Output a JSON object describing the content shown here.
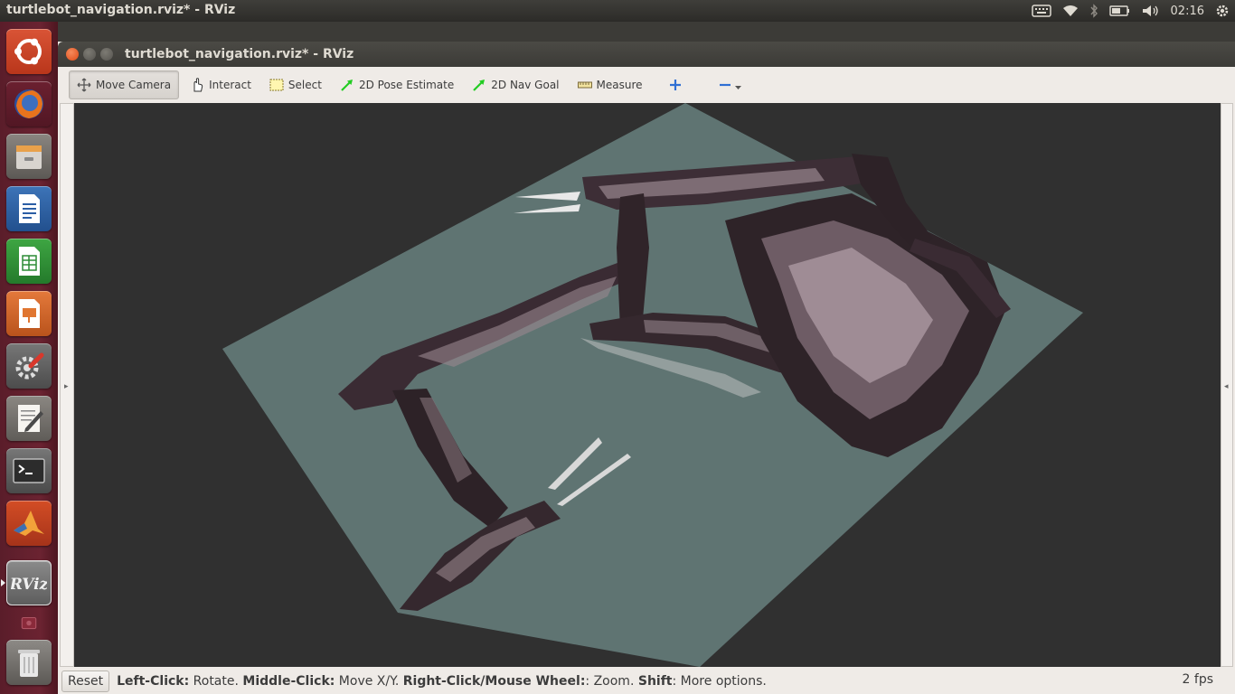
{
  "top_panel": {
    "title": "turtlebot_navigation.rviz* - RViz",
    "clock": "02:16",
    "tray_icons": [
      "keyboard-icon",
      "wifi-icon",
      "bluetooth-icon",
      "battery-icon",
      "volume-icon",
      "gear-icon"
    ]
  },
  "launcher": {
    "items": [
      {
        "name": "ubuntu-dash-icon"
      },
      {
        "name": "firefox-icon"
      },
      {
        "name": "files-icon"
      },
      {
        "name": "libreoffice-writer-icon"
      },
      {
        "name": "libreoffice-calc-icon"
      },
      {
        "name": "libreoffice-impress-icon"
      },
      {
        "name": "system-settings-icon"
      },
      {
        "name": "text-editor-icon"
      },
      {
        "name": "terminal-icon"
      },
      {
        "name": "matlab-icon"
      },
      {
        "name": "rviz-icon",
        "label": "RViz"
      },
      {
        "name": "workspace-icon"
      },
      {
        "name": "trash-icon"
      }
    ]
  },
  "window": {
    "title": "turtlebot_navigation.rviz* - RViz"
  },
  "toolbar": {
    "move_camera": "Move Camera",
    "interact": "Interact",
    "select": "Select",
    "pose_estimate": "2D Pose Estimate",
    "nav_goal": "2D Nav Goal",
    "measure": "Measure"
  },
  "colors": {
    "floor_plane": "#5f7472",
    "viewport_bg": "#303030",
    "point_cloud": "#3a2b33",
    "nav_arrow": "#22cc22"
  },
  "statusbar": {
    "reset": "Reset",
    "left_click_key": "Left-Click:",
    "left_click_desc": " Rotate. ",
    "middle_click_key": "Middle-Click:",
    "middle_click_desc": " Move X/Y. ",
    "right_click_key": "Right-Click/Mouse Wheel:",
    "right_click_desc": ": Zoom. ",
    "shift_key": "Shift",
    "shift_desc": ": More options.",
    "fps": "2 fps"
  }
}
